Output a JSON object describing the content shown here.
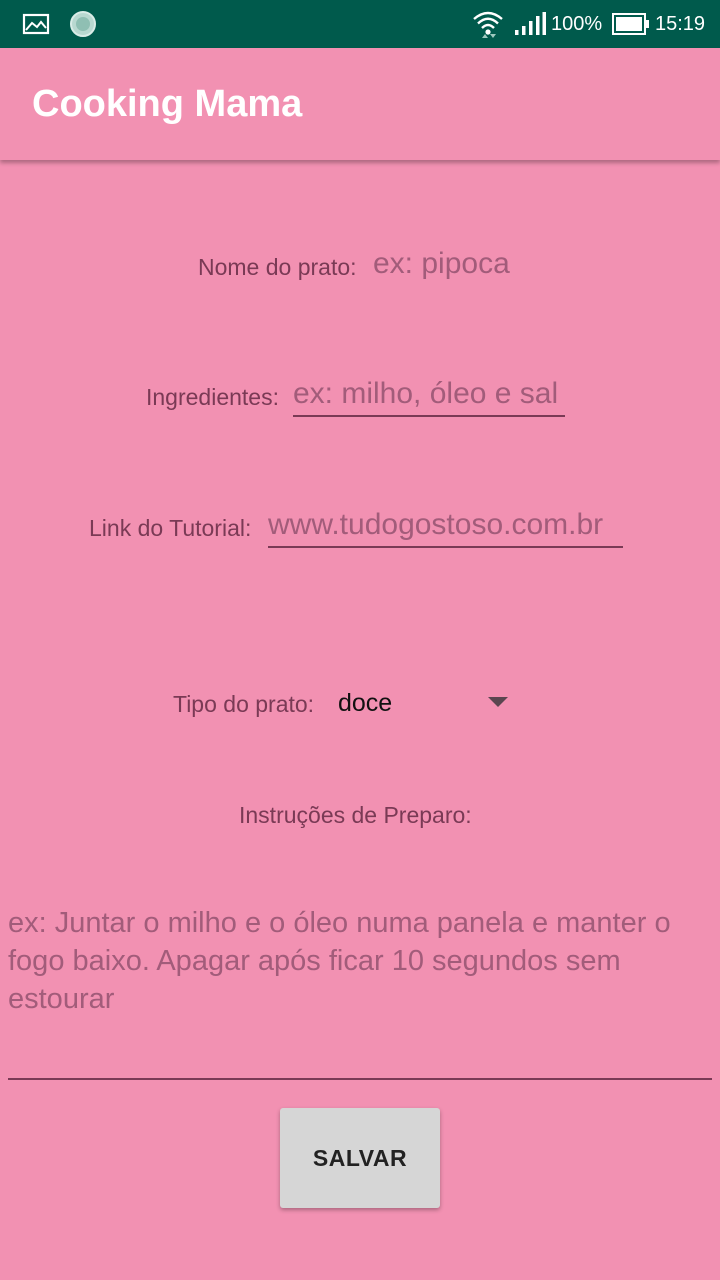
{
  "status_bar": {
    "battery_percent": "100%",
    "time": "15:19",
    "icons": [
      "image-icon",
      "sync-icon",
      "wifi-icon",
      "signal-icon",
      "battery-icon"
    ]
  },
  "app_bar": {
    "title": "Cooking Mama"
  },
  "form": {
    "dish_name": {
      "label": "Nome do prato:",
      "placeholder": "ex: pipoca"
    },
    "ingredients": {
      "label": "Ingredientes:",
      "placeholder": "ex: milho, óleo e sal"
    },
    "tutorial_link": {
      "label": "Link do Tutorial:",
      "placeholder": "www.tudogostoso.com.br"
    },
    "dish_type": {
      "label": "Tipo do prato:",
      "selected": "doce"
    },
    "instructions": {
      "label": "Instruções de Preparo:",
      "placeholder": "ex: Juntar o milho e o óleo numa panela e manter o fogo baixo. Apagar após ficar 10 segundos sem estourar"
    },
    "save_label": "SALVAR"
  },
  "colors": {
    "status_bar": "#005a4c",
    "background": "#f291b2",
    "label_text": "#7a3a55",
    "placeholder_text": "#a25c7a",
    "button_bg": "#d6d6d6"
  }
}
